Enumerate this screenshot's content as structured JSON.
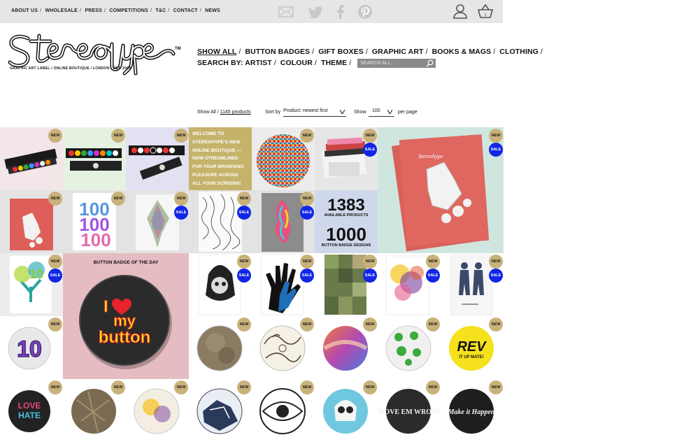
{
  "topnav": {
    "links": [
      "ABOUT US",
      "WHOLESALE",
      "PRESS",
      "COMPETITIONS",
      "T&C",
      "CONTACT",
      "NEWS"
    ],
    "cart_count": "1"
  },
  "brand": {
    "tagline": "GRAPHIC ART LABEL / ONLINE BOUTIQUE / LONDON / EST. 2004"
  },
  "mainnav": {
    "row1": [
      "SHOW ALL",
      "BUTTON BADGES",
      "GIFT BOXES",
      "GRAPHIC ART",
      "BOOKS & MAGS",
      "CLOTHING"
    ],
    "search_label": "SEARCH BY:",
    "row2": [
      "ARTIST",
      "COLOUR",
      "THEME"
    ],
    "search_placeholder": "SEARCH ALL..."
  },
  "filters": {
    "show_all": "Show All /",
    "count": "1145 products",
    "sort_label": "Sort by",
    "sort_value": "Product: newest first",
    "show_label": "Show",
    "show_value": "100",
    "per_page": "per page"
  },
  "welcome_text": "WELCOME TO STEREOHYPE'S NEW ONLINE BOUTIQUE — NOW STREAMLINED FOR YOUR BROWSING PLEASURE ACROSS ALL YOUR SCREENS!",
  "stats": {
    "products_number": "1383",
    "products_label": "AVAILABLE PRODUCTS",
    "designs_number": "1000",
    "designs_label": "BUTTON BADGE DESIGNS"
  },
  "badge_of_day": {
    "title": "BUTTON BADGE OF THE DAY",
    "line1": "I",
    "line2": "my",
    "line3": "button"
  },
  "labels": {
    "new": "NEW",
    "sale": "SALE"
  },
  "badge_texts": {
    "rev": "REV",
    "rev_sub": "IT UP MATE!",
    "love": "LOVE",
    "hate": "HATE",
    "prove": "PROVE EM WRONG",
    "make": "Make it Happen",
    "ten": "10"
  },
  "colors": {
    "accent_new": "#c9b27a",
    "accent_sale": "#1226e6",
    "welcome_bg": "#c5b36b"
  }
}
